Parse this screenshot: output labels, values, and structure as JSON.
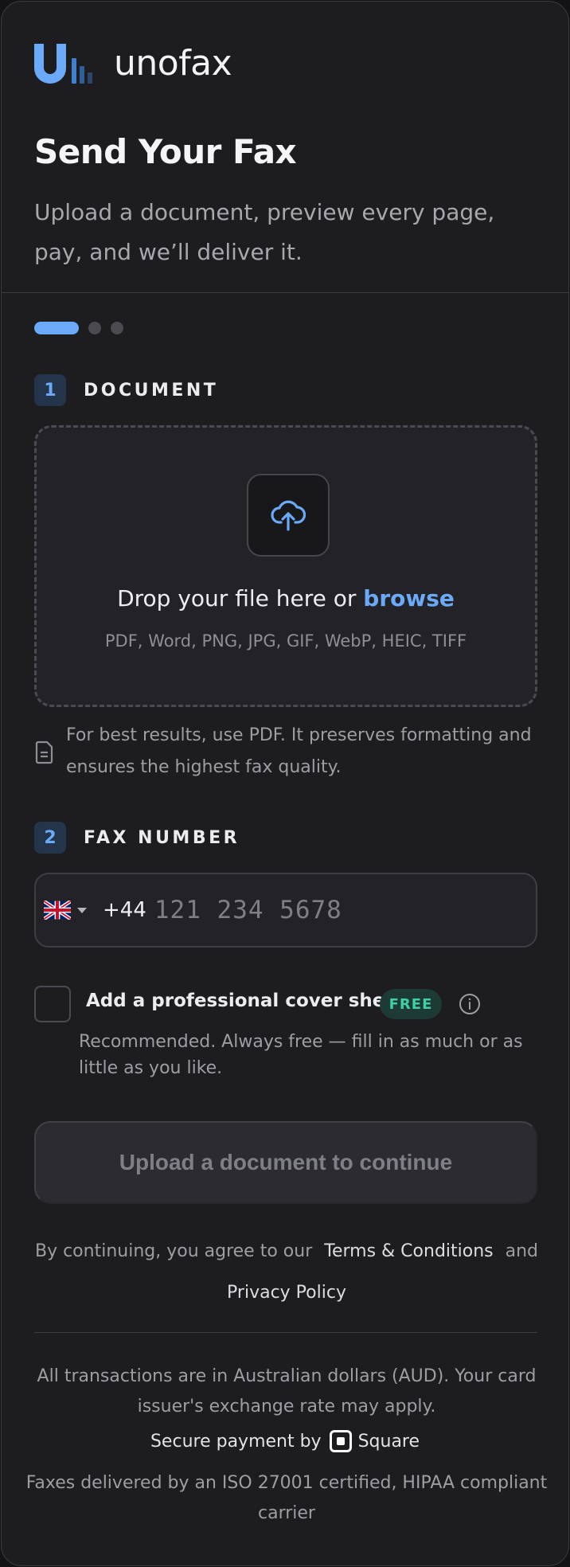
{
  "brand": {
    "name": "unofax",
    "accent_color": "#6aaaf8",
    "logo_icon": "unofax-logo-icon"
  },
  "header": {
    "title": "Send Your Fax",
    "subtitle": "Upload a document, preview every page, pay, and we’ll deliver it."
  },
  "progress": {
    "current_step": 1,
    "total_steps": 3
  },
  "document_step": {
    "number": "1",
    "label": "DOCUMENT",
    "upload_icon": "cloud-upload-icon",
    "drop_text": "Drop your file here or",
    "browse_label": "browse",
    "formats": "PDF, Word, PNG, JPG, GIF, WebP, HEIC, TIFF",
    "tip_icon": "document-icon",
    "tip": "For best results, use PDF. It preserves formatting and ensures the highest fax quality."
  },
  "fax_step": {
    "number": "2",
    "label": "FAX NUMBER",
    "country_flag": "uk-flag-icon",
    "dial_code": "+44",
    "number_value": "",
    "number_placeholder": "121 234 5678"
  },
  "cover_sheet": {
    "checked": false,
    "label": "Add a professional cover sheet",
    "badge": "FREE",
    "badge_color": "#3fcfa6",
    "info_icon": "info-icon",
    "note": "Recommended. Always free — fill in as much or as little as you like."
  },
  "cta": {
    "label": "Upload a document to continue",
    "enabled": false
  },
  "legal": {
    "prefix": "By continuing, you agree to our",
    "terms_label": "Terms & Conditions",
    "and": "and",
    "privacy_label": "Privacy Policy"
  },
  "footer": {
    "currency_note": "All transactions are in Australian dollars (AUD). Your card issuer's exchange rate may apply.",
    "secure_prefix": "Secure payment by",
    "payment_icon": "square-logo-icon",
    "payment_provider": "Square",
    "carrier_note": "Faxes delivered by an ISO 27001 certified, HIPAA compliant carrier"
  }
}
